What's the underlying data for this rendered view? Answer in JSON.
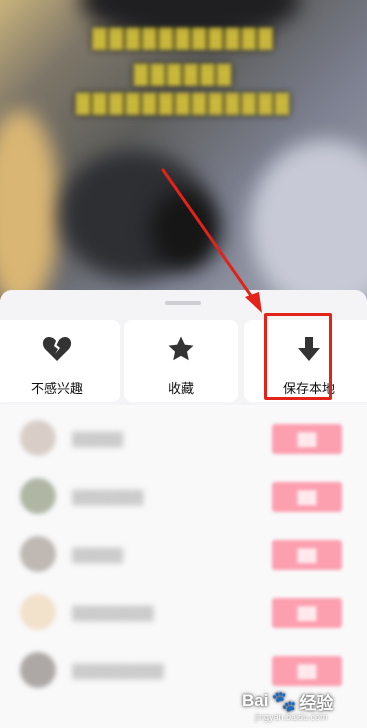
{
  "video": {
    "caption_lines": [
      "▓▓▓▓▓▓▓▓▓▓▓",
      "▓▓▓▓▓▓",
      "▓▓▓▓▓▓▓▓▓▓▓▓▓"
    ]
  },
  "sheet": {
    "actions": [
      {
        "label": "不感兴趣",
        "icon": "broken-heart-icon"
      },
      {
        "label": "收藏",
        "icon": "star-icon"
      },
      {
        "label": "保存本地",
        "icon": "download-arrow-icon"
      }
    ],
    "highlight_color": "#e1231a",
    "accent_color": "#fa5270"
  },
  "friends": [
    {
      "name": "▓▓▓▓▓",
      "button": "▓▓"
    },
    {
      "name": "▓▓▓▓▓▓▓",
      "button": "▓▓"
    },
    {
      "name": "▓▓▓▓▓",
      "button": "▓▓"
    },
    {
      "name": "▓▓▓▓▓▓▓▓",
      "button": "▓▓"
    },
    {
      "name": "▓▓▓▓▓▓▓▓▓",
      "button": "▓▓"
    }
  ],
  "watermark": {
    "brand": "Bai",
    "jingyan": "经验",
    "url": "jingyan.baidu.com"
  }
}
